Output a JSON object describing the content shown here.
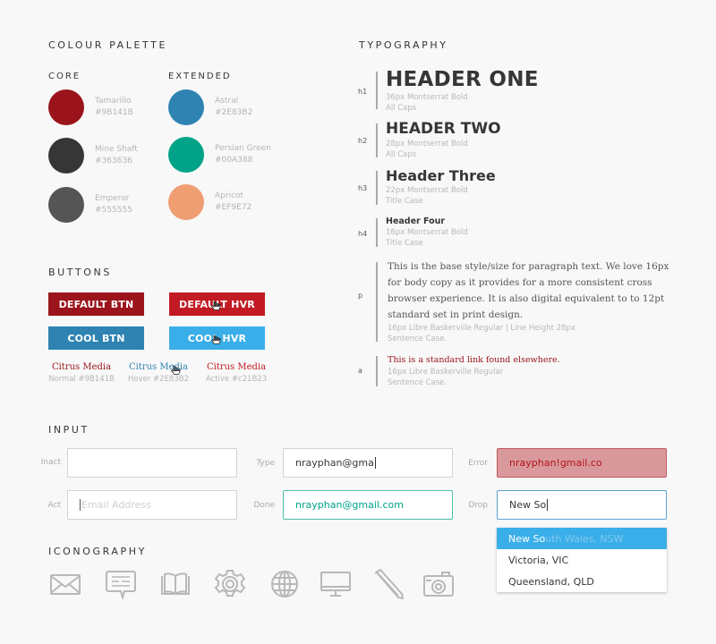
{
  "colour_palette": {
    "title": "COLOUR PALETTE",
    "core": {
      "title": "CORE",
      "swatches": [
        {
          "name": "Tamarillo",
          "hex": "#9B141B",
          "color": "#9b141b"
        },
        {
          "name": "Mine Shaft",
          "hex": "#363636",
          "color": "#363636"
        },
        {
          "name": "Emperor",
          "hex": "#555555",
          "color": "#555555"
        }
      ]
    },
    "extended": {
      "title": "EXTENDED",
      "swatches": [
        {
          "name": "Astral",
          "hex": "#2E83B2",
          "color": "#2e83b2"
        },
        {
          "name": "Persian Green",
          "hex": "#00A388",
          "color": "#00a388"
        },
        {
          "name": "Apricot",
          "hex": "#EF9E72",
          "color": "#ef9e72"
        }
      ]
    }
  },
  "buttons": {
    "title": "BUTTONS",
    "items": [
      {
        "label": "DEFAULT BTN",
        "color": "#9b141b"
      },
      {
        "label": "DEFAULT HVR",
        "color": "#c21b23"
      },
      {
        "label": "COOL BTN",
        "color": "#2e83b2"
      },
      {
        "label": "COOL HVR",
        "color": "#3aaee8"
      }
    ],
    "links": [
      {
        "label": "Citrus Media",
        "note": "Normal #9B141B",
        "color": "#9b141b"
      },
      {
        "label": "Citrus Media",
        "note": "Hover #2E83B2",
        "color": "#2e83b2"
      },
      {
        "label": "Citrus Media",
        "note": "Active #c21B23",
        "color": "#c21b23"
      }
    ]
  },
  "typography": {
    "title": "TYPOGRAPHY",
    "h1": {
      "tag": "h1",
      "sample": "HEADER ONE",
      "spec": "36px Montserrat Bold",
      "case": "All Caps"
    },
    "h2": {
      "tag": "h2",
      "sample": "HEADER TWO",
      "spec": "28px Montserrat Bold",
      "case": "All Caps"
    },
    "h3": {
      "tag": "h3",
      "sample": "Header Three",
      "spec": "22px Montserrat Bold",
      "case": "Title Case"
    },
    "h4": {
      "tag": "h4",
      "sample": "Header Four",
      "spec": "16px Montserrat Bold",
      "case": "Title Case"
    },
    "p": {
      "tag": "p",
      "sample": "This is the base style/size for paragraph text. We love 16px for body copy as it provides for a more consistent cross browser experience. It is also digital equivalent to to 12pt standard set in print design.",
      "spec": "16px Libre Baskerville Regular | Line Height 28px",
      "case": "Sentence Case."
    },
    "a": {
      "tag": "a",
      "sample": "This is a standard link found elsewhere.",
      "spec": "16px Libre Baskerville Regular",
      "case": "Sentence Case.",
      "color": "#9b141b"
    }
  },
  "input": {
    "title": "INPUT",
    "inact": {
      "label": "Inact",
      "value": ""
    },
    "act": {
      "label": "Act",
      "placeholder": "Email Address"
    },
    "type": {
      "label": "Type",
      "value": "nrayphan@gma"
    },
    "done": {
      "label": "Done",
      "value": "nrayphan@gmail.com"
    },
    "error": {
      "label": "Error",
      "value": "nrayphan!gmail.co"
    },
    "drop": {
      "label": "Drop",
      "value": "New So",
      "options": [
        {
          "typed": "New So",
          "rest": "uth Wales, NSW"
        },
        {
          "typed": "",
          "rest": "Victoria, VIC"
        },
        {
          "typed": "",
          "rest": "Queensland, QLD"
        }
      ]
    }
  },
  "iconography": {
    "title": "ICONOGRAPHY",
    "icons": [
      "envelope-icon",
      "chat-bubble-icon",
      "book-icon",
      "gear-icon",
      "globe-icon",
      "monitor-icon",
      "pencil-icon",
      "camera-icon"
    ]
  }
}
